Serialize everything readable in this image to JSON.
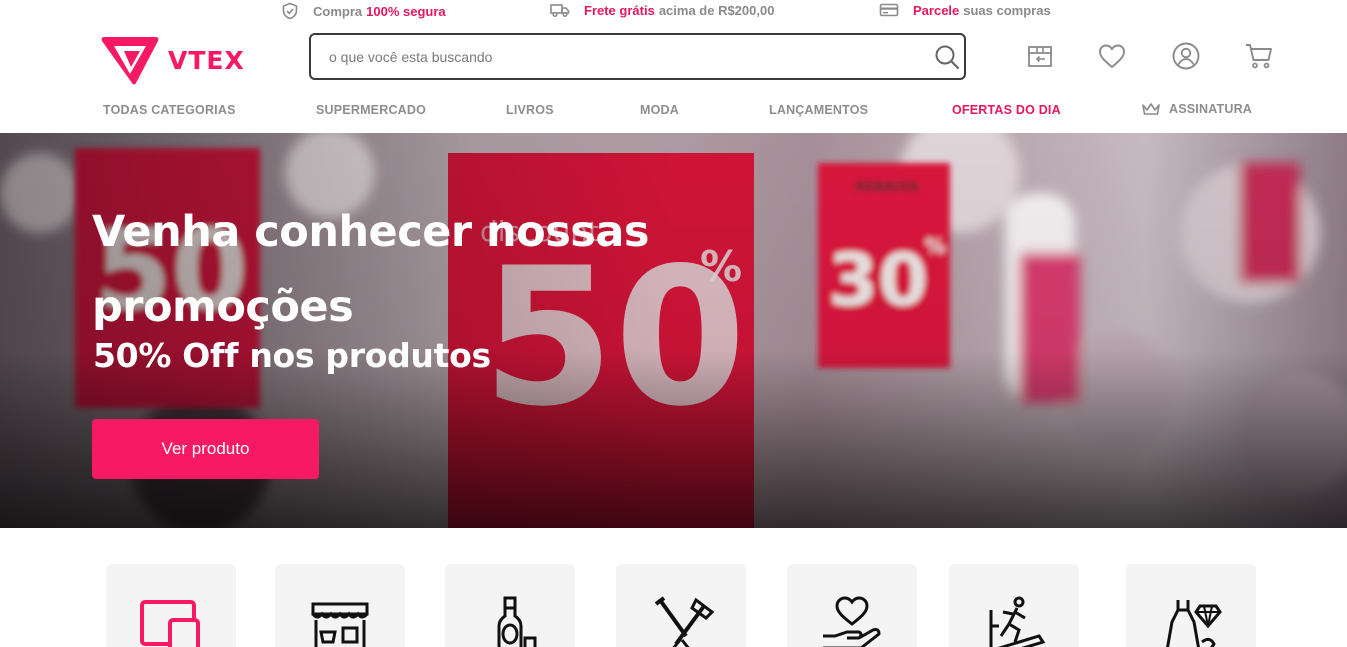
{
  "topbar": {
    "secure": {
      "prefix": "Compra",
      "highlight": "100% segura",
      "suffix": ""
    },
    "shipping": {
      "prefix": "",
      "highlight": "Frete grátis",
      "suffix": "acima de R$200,00"
    },
    "installments": {
      "prefix": "",
      "highlight": "Parcele",
      "suffix": "suas compras"
    }
  },
  "header": {
    "logo_text": "VTEX",
    "search_placeholder": "o que você esta buscando"
  },
  "nav": {
    "items": [
      {
        "label": "TODAS CATEGORIAS"
      },
      {
        "label": "SUPERMERCADO"
      },
      {
        "label": "LIVROS"
      },
      {
        "label": "MODA"
      },
      {
        "label": "LANÇAMENTOS"
      },
      {
        "label": "OFERTAS DO DIA"
      },
      {
        "label": "ASSINATURA"
      }
    ]
  },
  "hero": {
    "title": "Venha conhecer nossas promoções",
    "subtitle": "50% Off nos produtos",
    "button_label": "Ver produto",
    "sign_left": "50",
    "sign_center": "50",
    "sign_center_pct": "%",
    "sign_center_top": "discount",
    "sign_right": "30",
    "sign_right_pct": "%",
    "sign_right_top": "REBAIXA"
  },
  "categories": {
    "icons": [
      "devices-icon",
      "market-icon",
      "drinks-icon",
      "tools-icon",
      "health-icon",
      "fitness-icon",
      "fashion-icon"
    ]
  },
  "colors": {
    "brand": "#f71963",
    "text_muted": "#8d8d8d",
    "border_dark": "#3b3b3b"
  }
}
